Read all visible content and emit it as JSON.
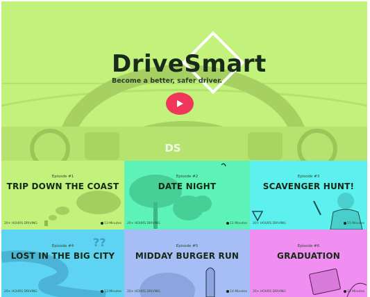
{
  "hero": {
    "logo": "DriveSmart",
    "tagline": "Become a better, safer driver.",
    "badge": "DS",
    "play_icon": "play-icon",
    "colors": {
      "background": "#c3f27c",
      "play": "#f0365a"
    }
  },
  "episodes": [
    {
      "number": "Episode #1",
      "title": "TRIP DOWN THE COAST",
      "hours": "20+ HOURS DRIVING",
      "duration": "13 Minutes",
      "color": "#c3f27c"
    },
    {
      "number": "Episode #2",
      "title": "DATE NIGHT",
      "hours": "20+ HOURS DRIVING",
      "duration": "11 Minutes",
      "color": "#5df2b8"
    },
    {
      "number": "Episode #3",
      "title": "SCAVENGER HUNT!",
      "hours": "20+ HOURS DRIVING",
      "duration": "15 Minutes",
      "color": "#5cf0ee"
    },
    {
      "number": "Episode #4",
      "title": "LOST IN THE BIG CITY",
      "hours": "20+ HOURS DRIVING",
      "duration": "13 Minutes",
      "color": "#5ed3f2"
    },
    {
      "number": "Episode #5",
      "title": "MIDDAY BURGER RUN",
      "hours": "20+ HOURS DRIVING",
      "duration": "14 Minutes",
      "color": "#a6bdf5"
    },
    {
      "number": "Episode #6",
      "title": "GRADUATION",
      "hours": "20+ HOURS DRIVING",
      "duration": "12 Minutes",
      "color": "#f08ef2"
    }
  ]
}
